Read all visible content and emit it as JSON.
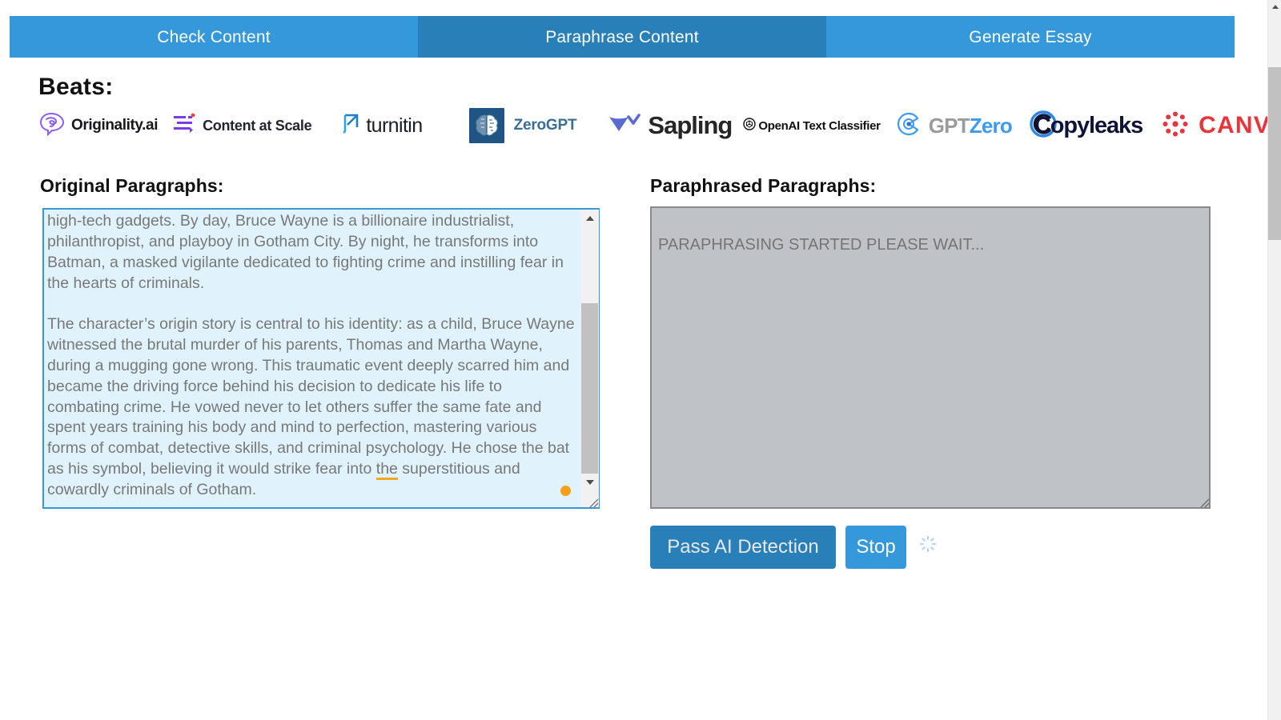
{
  "tabs": [
    {
      "label": "Check Content",
      "active": false
    },
    {
      "label": "Paraphrase Content",
      "active": true
    },
    {
      "label": "Generate Essay",
      "active": false
    }
  ],
  "beats": {
    "title": "Beats:",
    "logos": [
      {
        "name": "Originality.ai",
        "icon": "brain-speech-bubble-icon",
        "color": "#8b5cf6"
      },
      {
        "name": "Content at Scale",
        "icon": "lines-dot-icon",
        "color": "#7c3aed"
      },
      {
        "name": "turnitin",
        "icon": "arrow-square-icon",
        "color": "#2ca4dd"
      },
      {
        "name": "ZeroGPT",
        "icon": "brain-square-icon",
        "color": "#1f5582"
      },
      {
        "name": "Sapling",
        "icon": "chevron-leaf-icon",
        "color": "#5b6ad0"
      },
      {
        "name": "OpenAI Text Classifier",
        "icon": "openai-knot-icon",
        "color": "#101010"
      },
      {
        "name_part1": "GPT",
        "name_part2": "Zero",
        "icon": "target-circle-icon",
        "color": "#3d9bf5"
      },
      {
        "name": "Copyleaks",
        "icon": "c-circle-icon",
        "color": "#2f86e0"
      },
      {
        "name": "CANVAS",
        "icon": "canvas-dots-icon",
        "color": "#e8343a"
      }
    ]
  },
  "original": {
    "label": "Original Paragraphs:",
    "text": "high-tech gadgets. By day, Bruce Wayne is a billionaire industrialist, philanthropist, and playboy in Gotham City. By night, he transforms into Batman, a masked vigilante dedicated to fighting crime and instilling fear in the hearts of criminals.",
    "text_part2_before": "The character’s origin story is central to his identity: as a child, Bruce Wayne witnessed the brutal murder of his parents, Thomas and Martha Wayne, during a mugging gone wrong. This traumatic event deeply scarred him and became the driving force behind his decision to dedicate his life to combating crime. He vowed never to let others suffer the same fate and spent years training his body and mind to perfection, mastering various forms of combat, detective skills, and criminal psychology. He chose the bat as his symbol, believing it would strike fear into ",
    "text_part2_flagged": "the",
    "text_part2_after": " superstitious and cowardly criminals of Gotham."
  },
  "paraphrased": {
    "label": "Paraphrased Paragraphs:",
    "placeholder": "PARAPHRASING STARTED PLEASE WAIT...",
    "value": ""
  },
  "actions": {
    "pass_label": "Pass AI Detection",
    "stop_label": "Stop",
    "spinner": "loading-spinner-icon"
  },
  "colors": {
    "tab_inactive": "#3498db",
    "tab_active": "#2980b9",
    "original_bg": "#e0f2fb",
    "paraphrased_bg": "#bfc2c7",
    "grammar_underline": "#f5a623"
  }
}
